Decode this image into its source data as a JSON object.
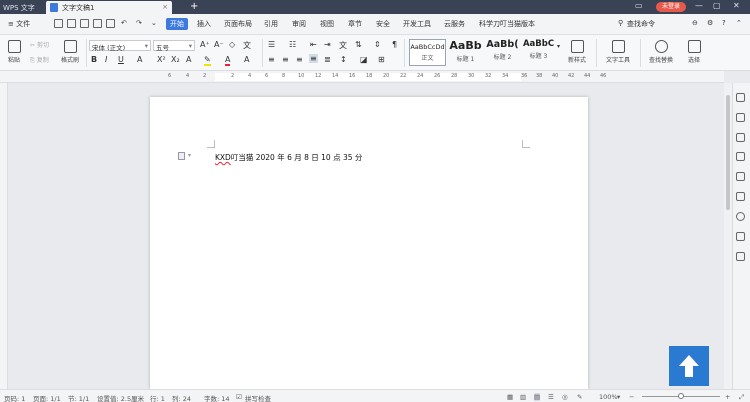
{
  "titlebar": {
    "app_tab": "WPS 文字",
    "doc_tab": "文字文稿1",
    "new_tab": "+",
    "login": "未登录"
  },
  "menu": {
    "file": "≡ 文件",
    "items": [
      "开始",
      "插入",
      "页面布局",
      "引用",
      "审阅",
      "视图",
      "章节",
      "安全",
      "开发工具",
      "云服务",
      "科学刀叮当猫版本"
    ],
    "search": "查找命令"
  },
  "ribbon": {
    "paste": "粘贴",
    "cut": "剪切",
    "copy": "复制",
    "format_painter": "格式刷",
    "font_name": "宋体 (正文)",
    "font_size": "五号",
    "styles": [
      {
        "sample": "AaBbCcDd",
        "label": "正文"
      },
      {
        "sample": "AaBb",
        "label": "标题 1"
      },
      {
        "sample": "AaBb(",
        "label": "标题 2"
      },
      {
        "sample": "AaBbC",
        "label": "标题 3"
      }
    ],
    "new_style": "新样式",
    "text_tools": "文字工具",
    "find_replace": "查找替换",
    "select": "选择"
  },
  "ruler": {
    "numbers": [
      "6",
      "4",
      "2",
      "2",
      "4",
      "6",
      "8",
      "10",
      "12",
      "14",
      "16",
      "18",
      "20",
      "22",
      "24",
      "26",
      "28",
      "30",
      "32",
      "34",
      "36",
      "38",
      "40",
      "42",
      "44",
      "46"
    ]
  },
  "document": {
    "text_underlined": "KXD",
    "text_rest": "叮当猫 2020 年 6 月 8 日 10 点 35 分"
  },
  "status": {
    "page_no": "页码: 1",
    "pages": "页面: 1/1",
    "section": "节: 1/1",
    "setting": "设置值: 2.5厘米",
    "row": "行: 1",
    "column": "列: 24",
    "word_count": "字数: 14",
    "spell": "拼写检查",
    "zoom": "100%"
  },
  "colors": {
    "accent": "#3d7ae0",
    "titlebar": "#3a4356",
    "float_button": "#2b7ad1",
    "login": "#e75a4b"
  }
}
